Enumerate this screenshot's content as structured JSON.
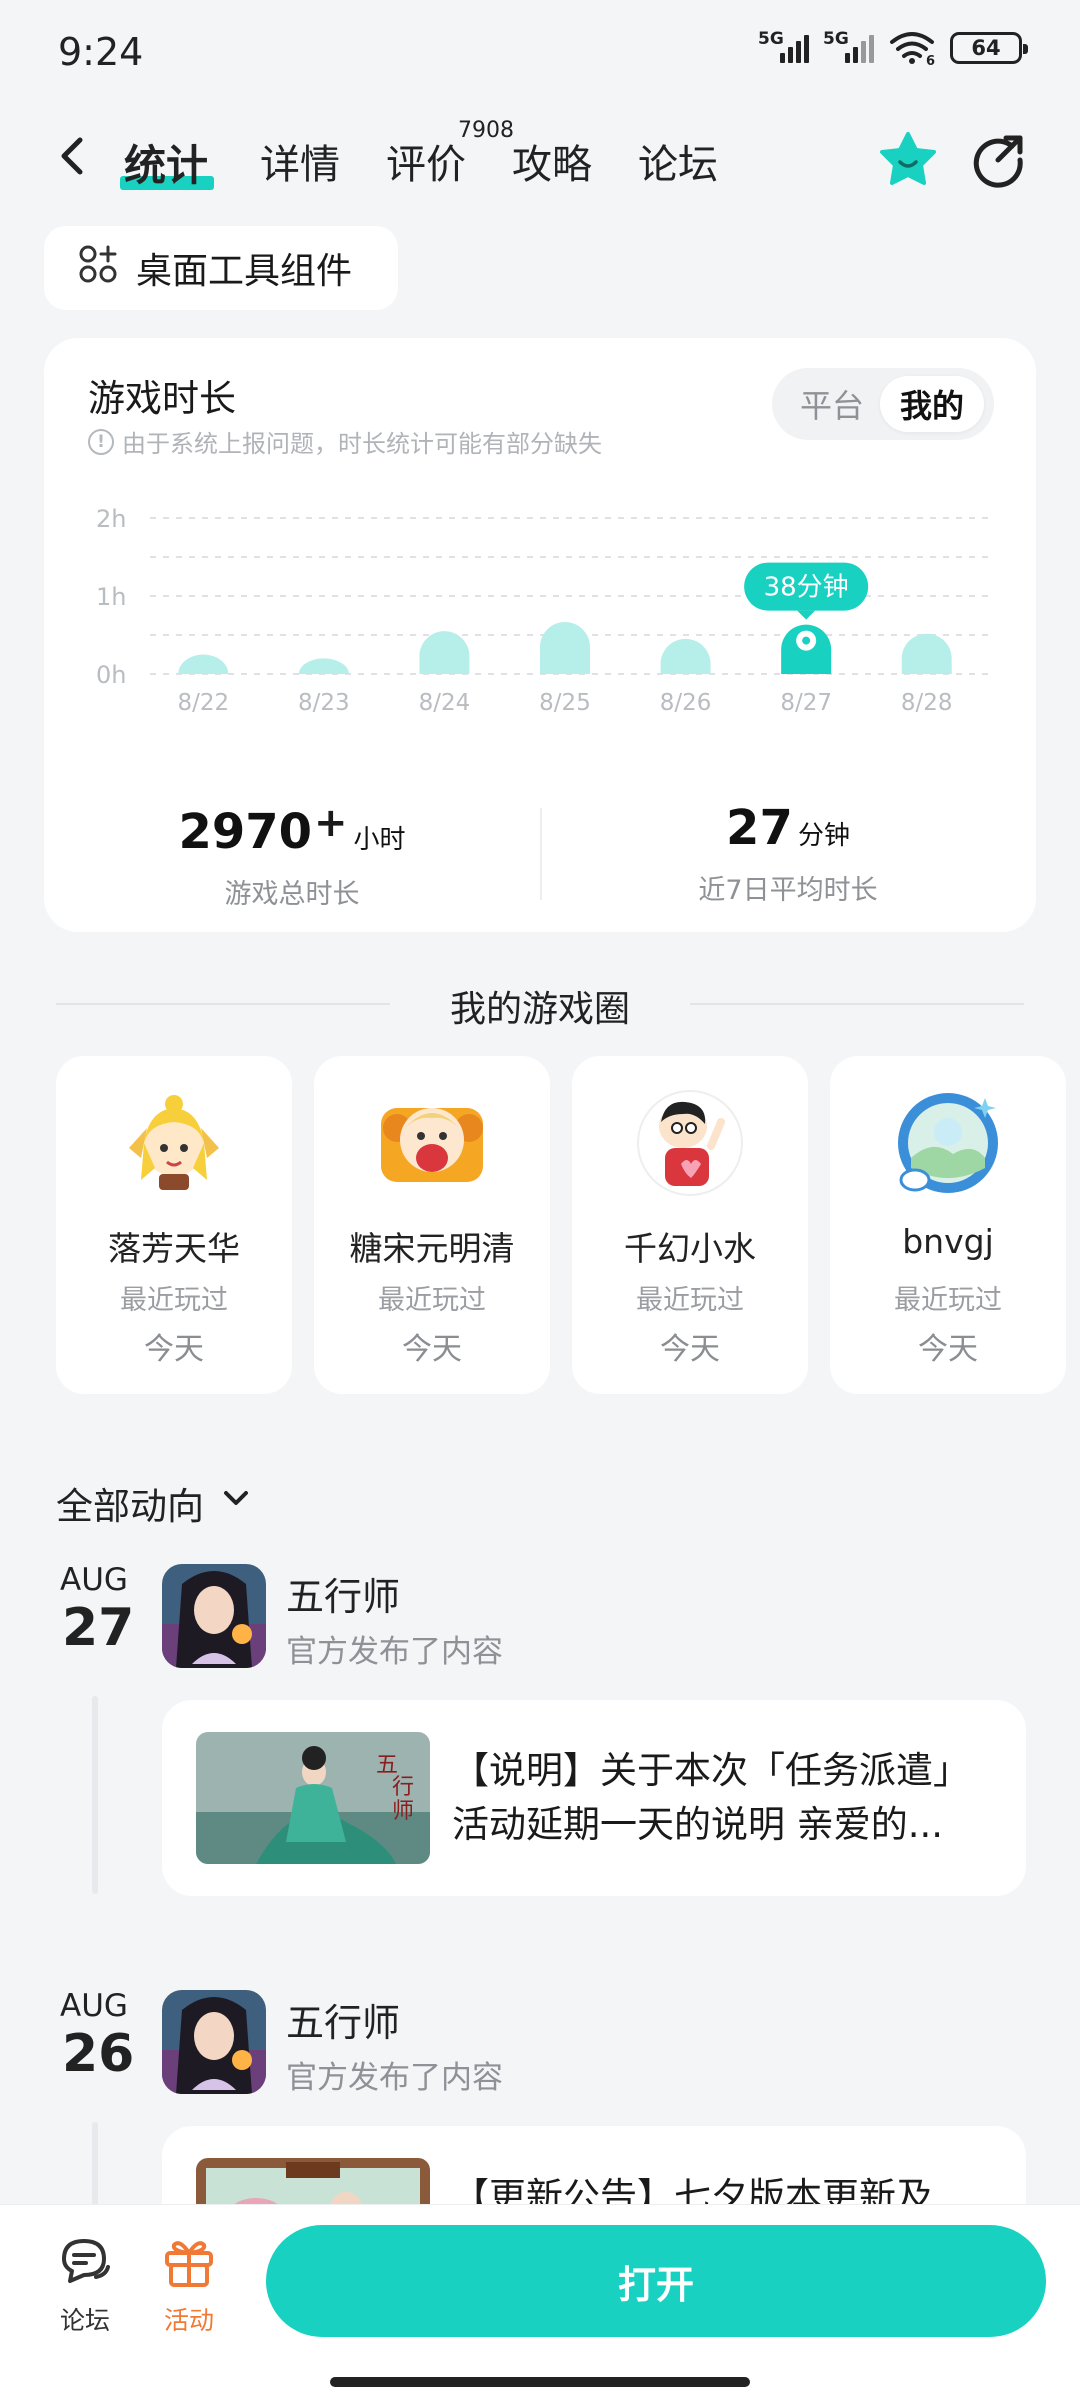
{
  "status_bar": {
    "time": "9:24",
    "net1": "5G",
    "net2": "5G",
    "wifi_badge": "6",
    "battery": "64"
  },
  "nav": {
    "tabs": [
      {
        "label": "统计",
        "active": true
      },
      {
        "label": "详情",
        "active": false
      },
      {
        "label": "评价",
        "active": false,
        "badge": "7908"
      },
      {
        "label": "攻略",
        "active": false
      },
      {
        "label": "论坛",
        "active": false
      }
    ],
    "icons": [
      "back-icon",
      "favorite-star-icon",
      "share-icon"
    ],
    "accent_color": "#18d1c1"
  },
  "widget_button": {
    "label": "桌面工具组件",
    "icon": "widget-grid-icon"
  },
  "stats_card": {
    "title": "游戏时长",
    "note": "由于系统上报问题，时长统计可能有部分缺失",
    "toggle": {
      "options": [
        "平台",
        "我的"
      ],
      "selected": "我的"
    },
    "total": {
      "value": "2970",
      "plus": "+",
      "unit": "小时",
      "label": "游戏总时长"
    },
    "avg": {
      "value": "27",
      "unit": "分钟",
      "label": "近7日平均时长"
    }
  },
  "chart_data": {
    "type": "bar",
    "categories": [
      "8/22",
      "8/23",
      "8/24",
      "8/25",
      "8/26",
      "8/27",
      "8/28"
    ],
    "values_minutes": [
      15,
      12,
      33,
      40,
      27,
      38,
      31
    ],
    "highlight_index": 5,
    "highlight_label": "38分钟",
    "y_ticks": [
      "0h",
      "1h",
      "2h"
    ],
    "ylim_minutes": [
      0,
      120
    ],
    "grid": true,
    "bar_color": "#b6efea",
    "highlight_color": "#18d1c1"
  },
  "game_circle": {
    "title": "我的游戏圈",
    "friends": [
      {
        "name": "落芳天华",
        "recent": "最近玩过",
        "day": "今天",
        "avatar": "anime-avatar-icon"
      },
      {
        "name": "糖宋元明清",
        "recent": "最近玩过",
        "day": "今天",
        "avatar": "cartoon-avatar-icon"
      },
      {
        "name": "千幻小水",
        "recent": "最近玩过",
        "day": "今天",
        "avatar": "crayon-kid-avatar-icon"
      },
      {
        "name": "bnvgj",
        "recent": "最近玩过",
        "day": "今天",
        "avatar": "frame-avatar-icon"
      }
    ]
  },
  "feed": {
    "filter_label": "全部动向",
    "entries": [
      {
        "month": "AUG",
        "day": "27",
        "game": "五行师",
        "sub": "官方发布了内容",
        "post": "【说明】关于本次「任务派遣」活动延期一天的说明 亲爱的..."
      },
      {
        "month": "AUG",
        "day": "26",
        "game": "五行师",
        "sub": "官方发布了内容",
        "post": "【更新公告】七夕版本更新及"
      }
    ]
  },
  "bottom_bar": {
    "forum_label": "论坛",
    "activity_label": "活动",
    "open_label": "打开",
    "activity_color": "#f07a35"
  }
}
